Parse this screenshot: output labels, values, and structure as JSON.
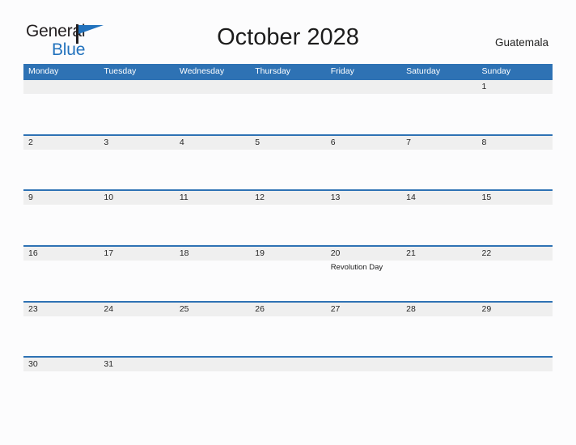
{
  "brand": {
    "word1": "General",
    "word2": "Blue",
    "mark": "blue-triangle-flag"
  },
  "header": {
    "title": "October 2028",
    "country": "Guatemala"
  },
  "calendar": {
    "weekdays": [
      "Monday",
      "Tuesday",
      "Wednesday",
      "Thursday",
      "Friday",
      "Saturday",
      "Sunday"
    ],
    "colors": {
      "header_blue": "#2e72b4",
      "row_band_gray": "#efefef",
      "page_background": "#fcfcfd",
      "text": "#252525",
      "brand_blue": "#2272bd"
    },
    "weeks": [
      [
        {
          "day": "",
          "event": ""
        },
        {
          "day": "",
          "event": ""
        },
        {
          "day": "",
          "event": ""
        },
        {
          "day": "",
          "event": ""
        },
        {
          "day": "",
          "event": ""
        },
        {
          "day": "",
          "event": ""
        },
        {
          "day": "1",
          "event": ""
        }
      ],
      [
        {
          "day": "2",
          "event": ""
        },
        {
          "day": "3",
          "event": ""
        },
        {
          "day": "4",
          "event": ""
        },
        {
          "day": "5",
          "event": ""
        },
        {
          "day": "6",
          "event": ""
        },
        {
          "day": "7",
          "event": ""
        },
        {
          "day": "8",
          "event": ""
        }
      ],
      [
        {
          "day": "9",
          "event": ""
        },
        {
          "day": "10",
          "event": ""
        },
        {
          "day": "11",
          "event": ""
        },
        {
          "day": "12",
          "event": ""
        },
        {
          "day": "13",
          "event": ""
        },
        {
          "day": "14",
          "event": ""
        },
        {
          "day": "15",
          "event": ""
        }
      ],
      [
        {
          "day": "16",
          "event": ""
        },
        {
          "day": "17",
          "event": ""
        },
        {
          "day": "18",
          "event": ""
        },
        {
          "day": "19",
          "event": ""
        },
        {
          "day": "20",
          "event": "Revolution Day"
        },
        {
          "day": "21",
          "event": ""
        },
        {
          "day": "22",
          "event": ""
        }
      ],
      [
        {
          "day": "23",
          "event": ""
        },
        {
          "day": "24",
          "event": ""
        },
        {
          "day": "25",
          "event": ""
        },
        {
          "day": "26",
          "event": ""
        },
        {
          "day": "27",
          "event": ""
        },
        {
          "day": "28",
          "event": ""
        },
        {
          "day": "29",
          "event": ""
        }
      ],
      [
        {
          "day": "30",
          "event": ""
        },
        {
          "day": "31",
          "event": ""
        },
        {
          "day": "",
          "event": ""
        },
        {
          "day": "",
          "event": ""
        },
        {
          "day": "",
          "event": ""
        },
        {
          "day": "",
          "event": ""
        },
        {
          "day": "",
          "event": ""
        }
      ]
    ]
  }
}
